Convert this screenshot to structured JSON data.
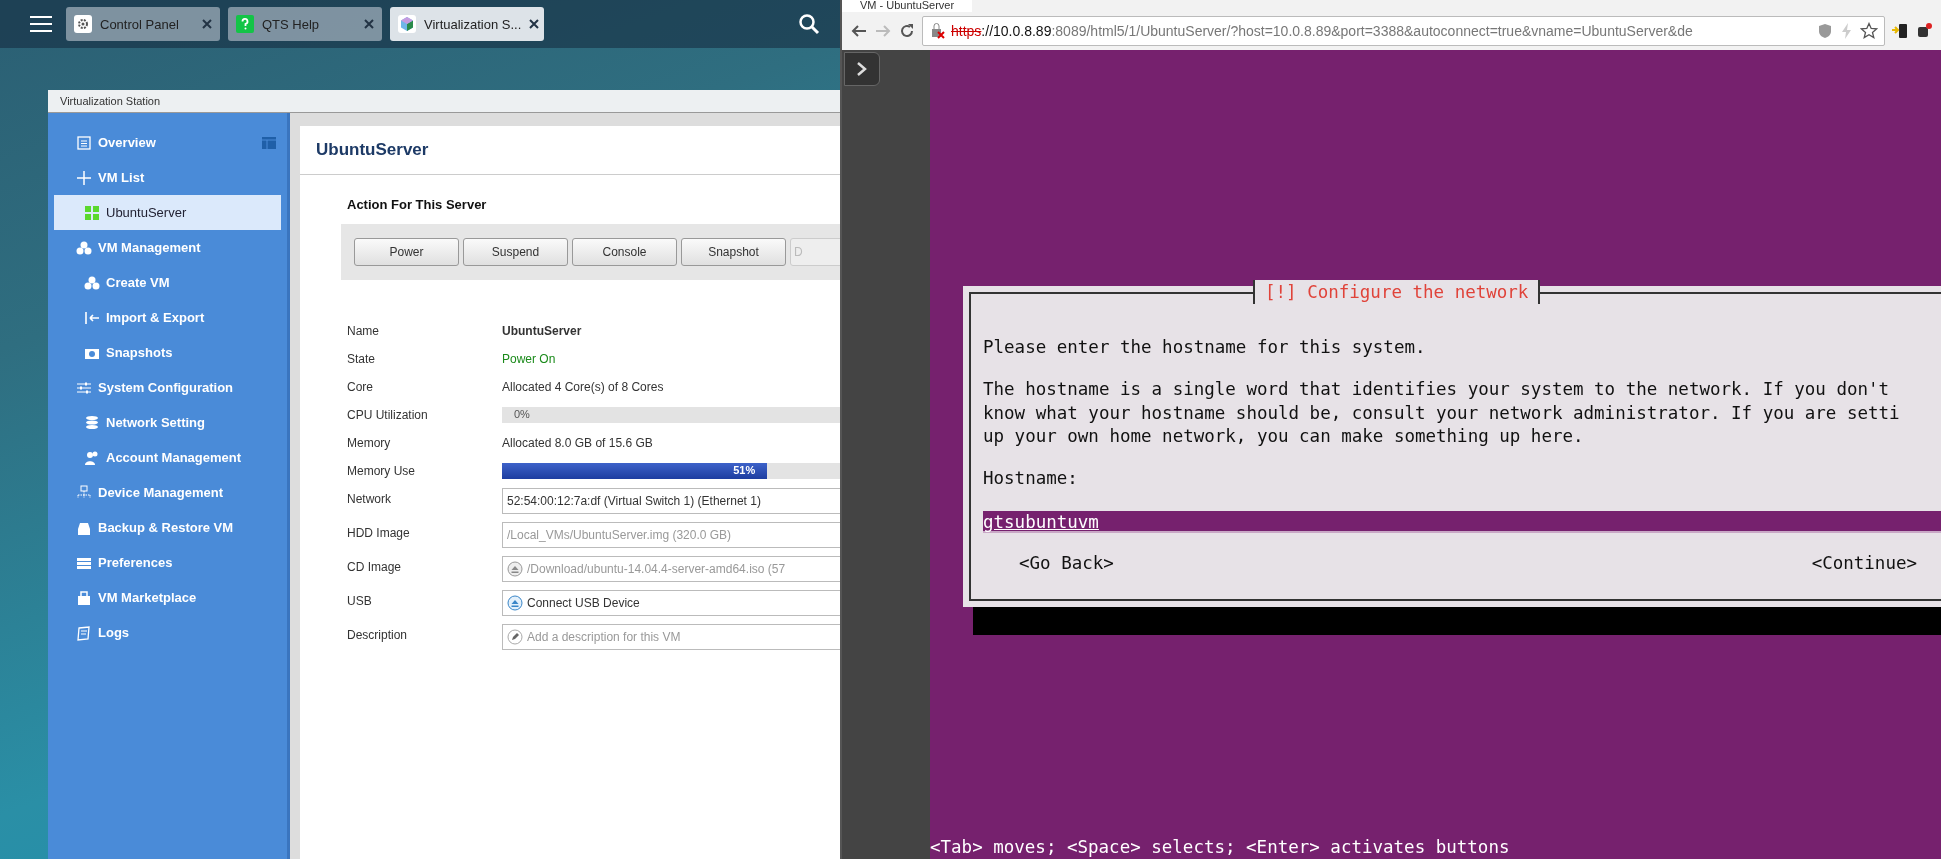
{
  "desktop": {
    "tabs": [
      {
        "label": "Control Panel",
        "selected": false
      },
      {
        "label": "QTS Help",
        "selected": false
      },
      {
        "label": "Virtualization S...",
        "selected": true
      }
    ]
  },
  "vs_window": {
    "title": "Virtualization Station",
    "sidebar": {
      "items": [
        {
          "label": "Overview",
          "selected": false
        },
        {
          "label": "VM List",
          "selected": false,
          "children": [
            {
              "label": "UbuntuServer",
              "selected": true
            }
          ]
        },
        {
          "label": "VM Management",
          "selected": false,
          "children": [
            {
              "label": "Create VM",
              "selected": false
            },
            {
              "label": "Import & Export",
              "selected": false
            },
            {
              "label": "Snapshots",
              "selected": false
            }
          ]
        },
        {
          "label": "System Configuration",
          "selected": false,
          "children": [
            {
              "label": "Network Setting",
              "selected": false
            },
            {
              "label": "Account Management",
              "selected": false
            }
          ]
        },
        {
          "label": "Device Management",
          "selected": false
        },
        {
          "label": "Backup & Restore VM",
          "selected": false
        },
        {
          "label": "Preferences",
          "selected": false
        },
        {
          "label": "VM Marketplace",
          "selected": false
        },
        {
          "label": "Logs",
          "selected": false
        }
      ]
    },
    "panel": {
      "title": "UbuntuServer",
      "actions_heading": "Action For This Server",
      "actions": [
        {
          "label": "Power",
          "disabled": false
        },
        {
          "label": "Suspend",
          "disabled": false
        },
        {
          "label": "Console",
          "disabled": false
        },
        {
          "label": "Snapshot",
          "disabled": false
        },
        {
          "label": "D",
          "disabled": true
        }
      ],
      "details": [
        {
          "label": "Name",
          "kind": "bold",
          "value": "UbuntuServer"
        },
        {
          "label": "State",
          "kind": "status",
          "value": "Power On"
        },
        {
          "label": "Core",
          "kind": "text",
          "value": "Allocated 4 Core(s) of 8 Cores"
        },
        {
          "label": "CPU Utilization",
          "kind": "meter",
          "level": 0,
          "reading": "0%"
        },
        {
          "label": "Memory",
          "kind": "text",
          "value": "Allocated 8.0 GB of 15.6 GB"
        },
        {
          "label": "Memory Use",
          "kind": "meter",
          "level": 0.51,
          "reading": "51%"
        },
        {
          "label": "Network",
          "kind": "field",
          "value": "52:54:00:12:7a:df (Virtual Switch 1) (Ethernet 1)"
        },
        {
          "label": "HDD Image",
          "kind": "readonly",
          "value": "/Local_VMs/UbuntuServer.img (320.0 GB)"
        },
        {
          "label": "CD Image",
          "kind": "eject",
          "value": "/Download/ubuntu-14.04.4-server-amd64.iso (57"
        },
        {
          "label": "USB",
          "kind": "usb",
          "value": "Connect USB Device"
        },
        {
          "label": "Description",
          "kind": "edit",
          "placeholder": "Add a description for this VM"
        }
      ]
    }
  },
  "browser": {
    "tab_title": "VM - UbuntuServer",
    "url": {
      "scheme": "https",
      "host": "://10.0.8.89",
      "rest": ":8089/html5/1/UbuntuServer/?host=10.0.8.89&port=3388&autoconnect=true&vname=UbuntuServer&de"
    }
  },
  "installer": {
    "title": "[!] Configure the network",
    "paragraphs": [
      [
        "Please enter the hostname for this system."
      ],
      [
        "The hostname is a single word that identifies your system to the network. If you don't",
        "know what your hostname should be, consult your network administrator. If you are setti",
        "up your own home network, you can make something up here."
      ]
    ],
    "field_label": "Hostname:",
    "hostname": "gtsubuntuvm",
    "buttons": [
      {
        "label": "<Go Back>"
      },
      {
        "label": "<Continue>"
      }
    ],
    "hint": "<Tab> moves; <Space> selects; <Enter> activates buttons"
  }
}
